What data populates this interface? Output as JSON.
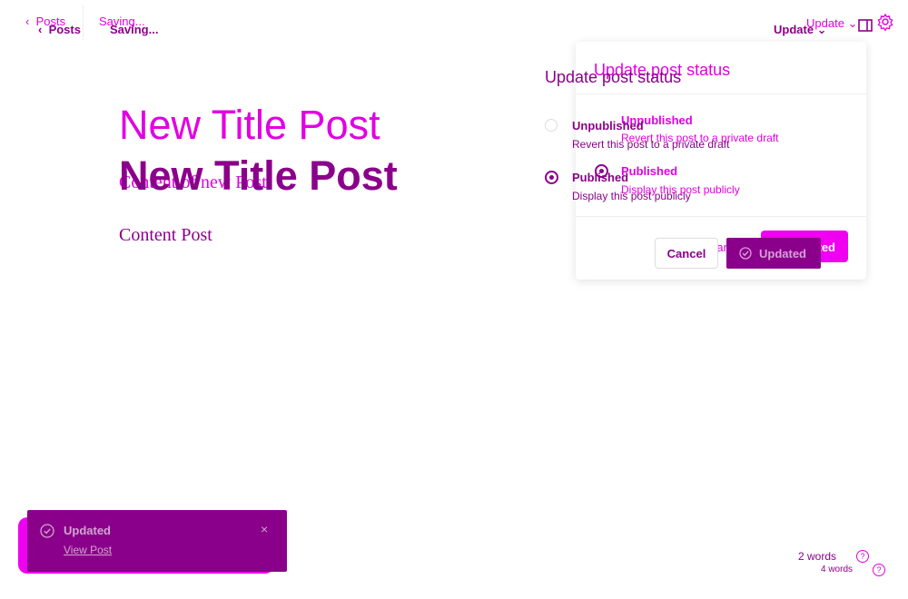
{
  "top_bar": {
    "back_label": "Posts",
    "saving_label": "Saving...",
    "update_label": "Update"
  },
  "editor": {
    "title": "New Title Post",
    "content_ghost": "Content of new Post",
    "content": "Content Post"
  },
  "status_panel": {
    "title": "Update post status",
    "options": [
      {
        "label": "Unpublished",
        "description": "Revert this post to a private draft",
        "selected": false
      },
      {
        "label": "Published",
        "description": "Display this post publicly",
        "selected": true
      }
    ],
    "cancel_label": "Cancel",
    "confirm_label": "Updated"
  },
  "snackbar": {
    "message": "Updated",
    "link_label": "View Post",
    "close_glyph": "×"
  },
  "footer": {
    "word_count_ghost": "2 words",
    "word_count": "4 words",
    "help_glyph": "?"
  },
  "colors": {
    "ghost": "#e100e1",
    "primary": "#8b008b"
  },
  "icons": [
    "chevron-left-icon",
    "chevron-down-icon",
    "sidebar-toggle-icon",
    "gear-icon",
    "check-circle-icon",
    "close-icon",
    "help-icon"
  ]
}
